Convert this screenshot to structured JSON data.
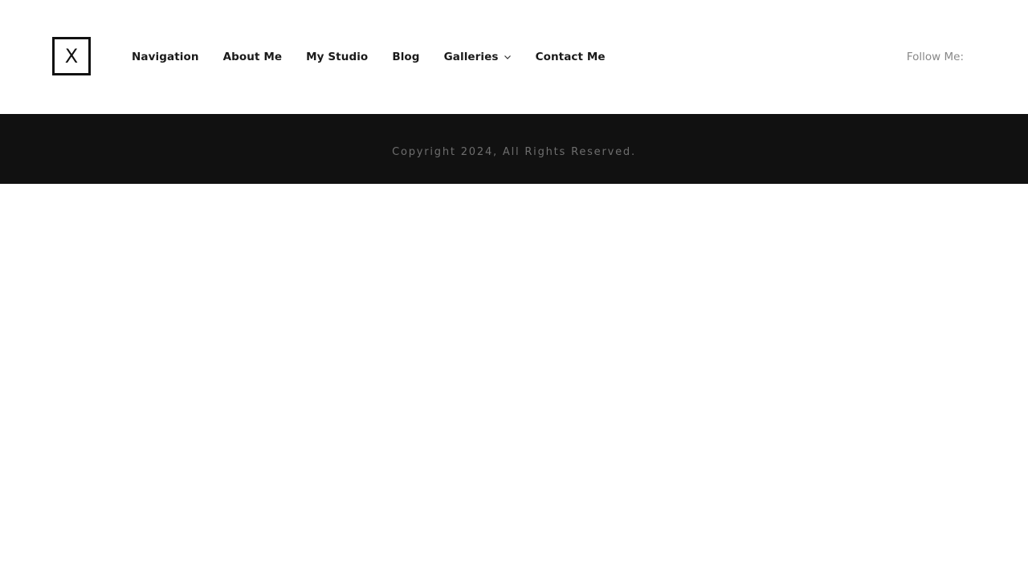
{
  "header": {
    "logo": {
      "text": "X"
    },
    "nav": {
      "items": [
        {
          "label": "Navigation"
        },
        {
          "label": "About Me"
        },
        {
          "label": "My Studio"
        },
        {
          "label": "Blog"
        },
        {
          "label": "Galleries",
          "has_dropdown": true
        },
        {
          "label": "Contact Me"
        }
      ]
    },
    "follow_label": "Follow Me:"
  },
  "footer": {
    "copyright": "Copyright 2024, All Rights Reserved."
  },
  "colors": {
    "background": "#ffffff",
    "footer_background": "#111111",
    "nav_text": "#1a1a1a",
    "muted_text": "#888888"
  },
  "icons": {
    "dropdown": "chevron-down-icon"
  }
}
